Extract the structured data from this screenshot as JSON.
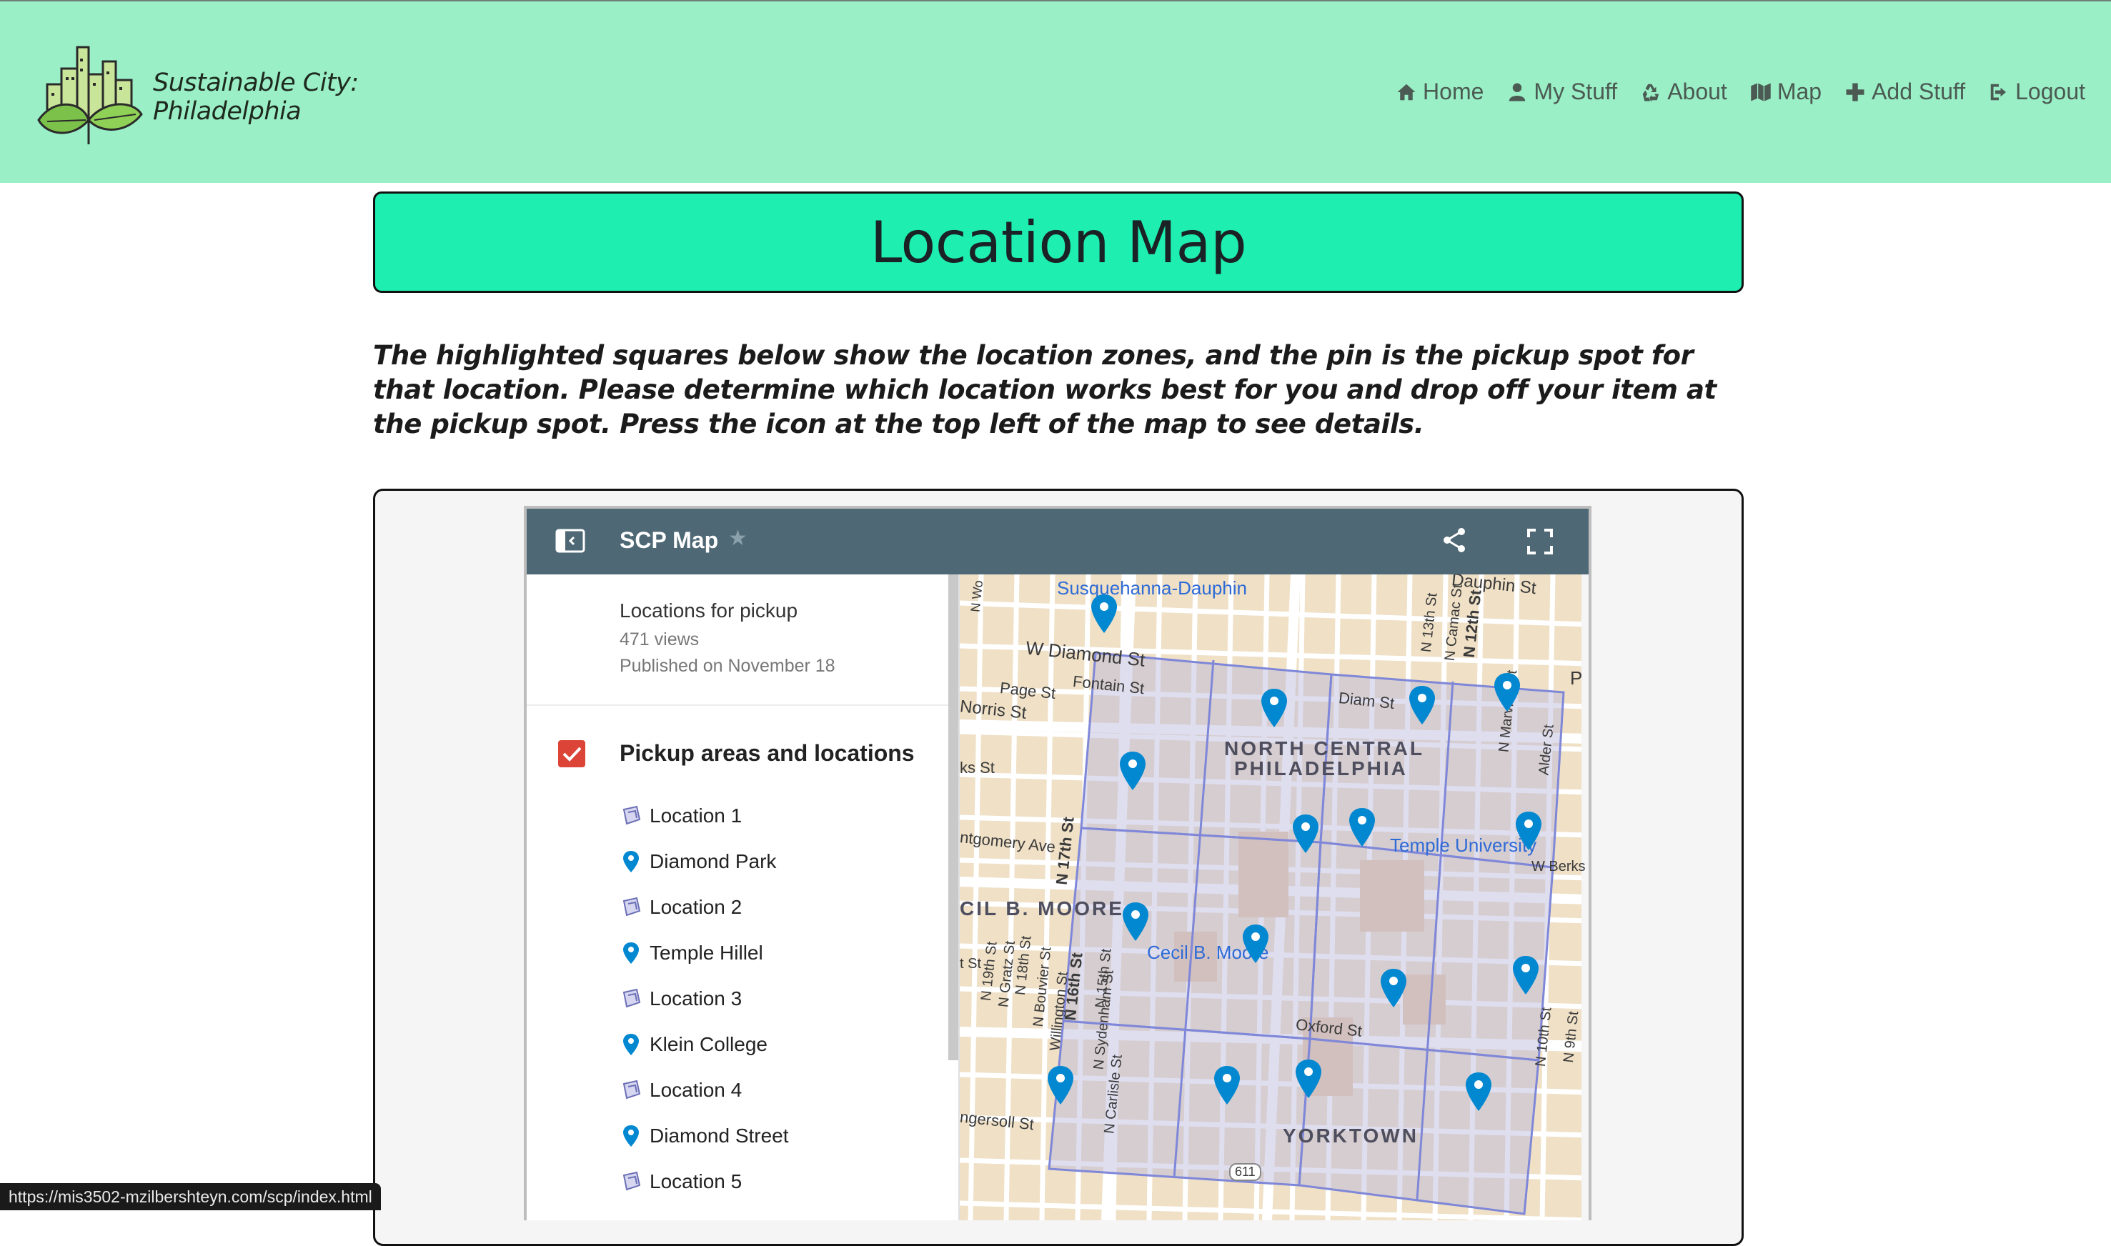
{
  "brand": {
    "line1": "Sustainable City:",
    "line2": "Philadelphia"
  },
  "nav": [
    {
      "label": "Home",
      "icon": "home-icon"
    },
    {
      "label": "My Stuff",
      "icon": "user-icon"
    },
    {
      "label": "About",
      "icon": "recycle-icon"
    },
    {
      "label": "Map",
      "icon": "map-icon"
    },
    {
      "label": "Add Stuff",
      "icon": "plus-icon"
    },
    {
      "label": "Logout",
      "icon": "logout-icon"
    }
  ],
  "page": {
    "title": "Location Map",
    "intro": "The highlighted squares below show the location zones, and the pin is the pickup spot for that location. Please determine which location works best for you and drop off your item at the pickup spot. Press the icon at the top left of the map to see details."
  },
  "embed": {
    "title": "SCP Map",
    "description": "Locations for pickup",
    "views": "471 views",
    "published": "Published on November 18",
    "layer": "Pickup areas and locations",
    "items": [
      {
        "label": "Location 1",
        "type": "polygon"
      },
      {
        "label": "Diamond Park",
        "type": "pin"
      },
      {
        "label": "Location 2",
        "type": "polygon"
      },
      {
        "label": "Temple Hillel",
        "type": "pin"
      },
      {
        "label": "Location 3",
        "type": "polygon"
      },
      {
        "label": "Klein College",
        "type": "pin"
      },
      {
        "label": "Location 4",
        "type": "polygon"
      },
      {
        "label": "Diamond Street",
        "type": "pin"
      },
      {
        "label": "Location 5",
        "type": "polygon"
      }
    ]
  },
  "map_labels": {
    "susquehanna": "Susquehanna-Dauphin",
    "dauphin_st": "Dauphin St",
    "w_diamond": "W Diamond St",
    "fontain": "Fontain St",
    "page_st": "Page St",
    "norris": "Norris St",
    "ks_st": "ks St",
    "montgomery": "ntgomery Ave",
    "north_central": "NORTH CENTRAL",
    "philadelphia": "PHILADELPHIA",
    "diamond_st": "Diam      St",
    "temple": "Temple University",
    "w_berks": "W Berks",
    "cecil_area": "CIL B. MOORE",
    "cecil_station": "Cecil B. Moore",
    "oxford": "Oxford St",
    "yorktown": "YORKTOWN",
    "gersoll": "ngersoll St",
    "route": "611",
    "p_letter": "P",
    "n_13th": "N 13th St",
    "n_12th": "N 12th St",
    "n_camac": "N Camac St",
    "n_marvine": "N Marvine St",
    "alder": "Alder St",
    "n_10th": "N 10th St",
    "n_9th": "N 9th St",
    "n_17th": "N 17th St",
    "n_16th": "N 16th St",
    "n_15th": "N 15th St",
    "n_19th": "N 19th St",
    "n_18th": "N 18th St",
    "n_gratz": "N Gratz St",
    "n_bouvier": "N Bouvier St",
    "willington": "Willington St",
    "n_sydenham": "N Sydenham St",
    "n_carlisle": "N Carlisle St",
    "t_st": "t St",
    "n_wo": "N Wo"
  },
  "status_url": "https://mis3502-mzilbershteyn.com/scp/index.html",
  "colors": {
    "navbar": "#9aefc6",
    "title_bg": "#1eeeb0",
    "map_header": "#4e6875",
    "checkbox": "#db4437",
    "pin": "#0288d1"
  }
}
